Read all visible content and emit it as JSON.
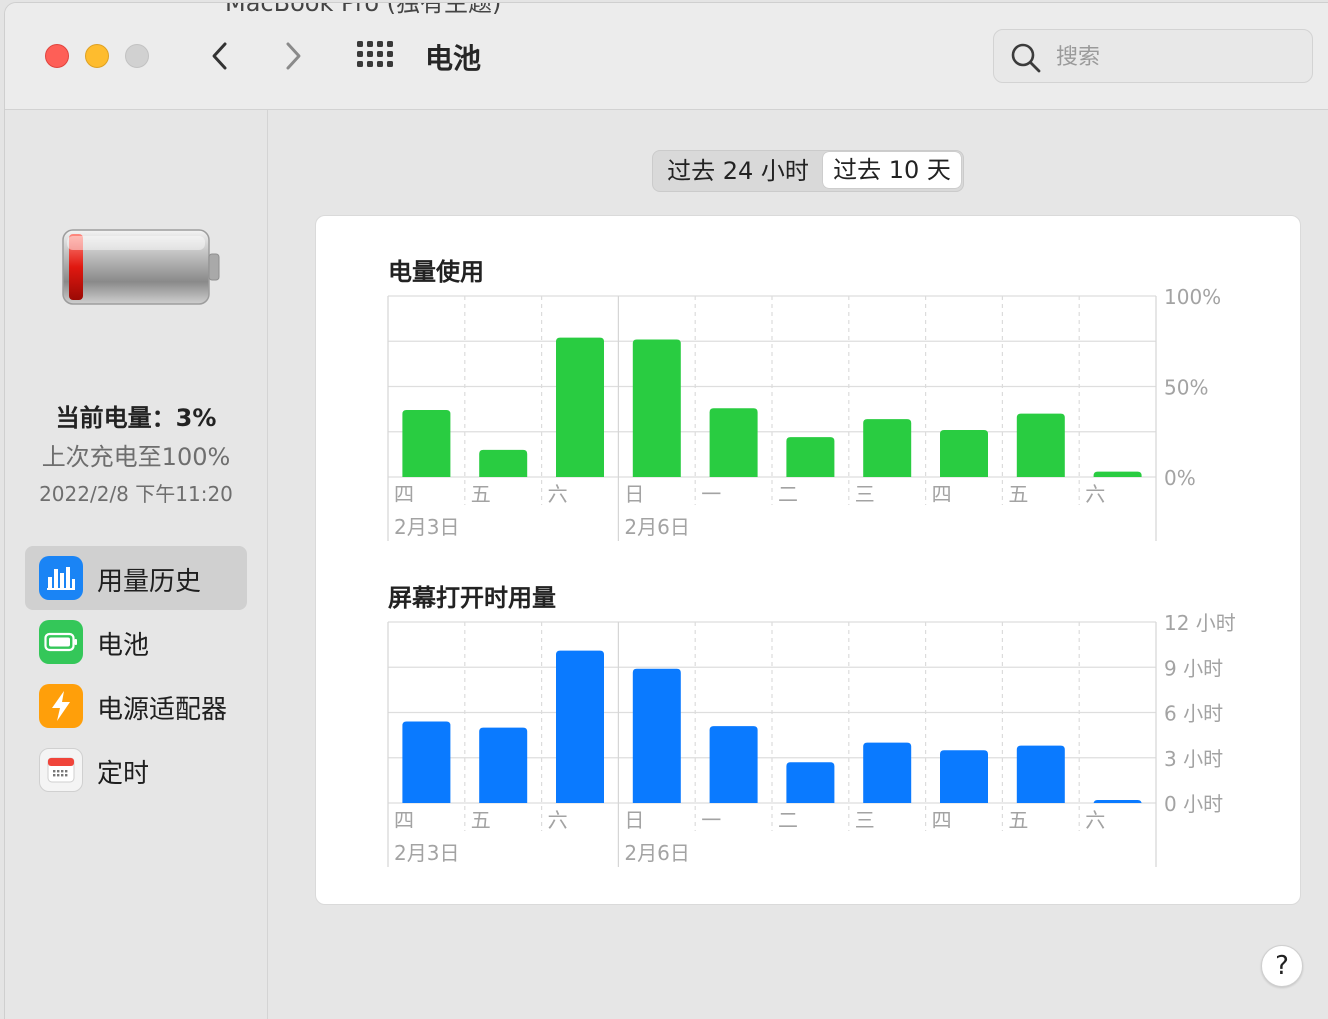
{
  "window": {
    "title": "电池",
    "ghost_title": "MacBook Pro (独有主题)"
  },
  "titlebar": {
    "search_placeholder": "搜索"
  },
  "sidebar": {
    "charge_level": "当前电量：3%",
    "last_charged": "上次充电至100%",
    "last_charged_time": "2022/2/8 下午11:20",
    "items": [
      {
        "label": "用量历史",
        "icon": "bar-chart-icon",
        "active": true
      },
      {
        "label": "电池",
        "icon": "battery-icon",
        "active": false
      },
      {
        "label": "电源适配器",
        "icon": "lightning-icon",
        "active": false
      },
      {
        "label": "定时",
        "icon": "calendar-icon",
        "active": false
      }
    ]
  },
  "range": {
    "option_24h": "过去 24 小时",
    "option_10d": "过去 10 天",
    "selected": "option_10d"
  },
  "chart_data": [
    {
      "type": "bar",
      "title": "电量使用",
      "categories": [
        "四",
        "五",
        "六",
        "日",
        "一",
        "二",
        "三",
        "四",
        "五",
        "六"
      ],
      "date_labels": [
        {
          "index": 0,
          "label": "2月3日"
        },
        {
          "index": 3,
          "label": "2月6日"
        }
      ],
      "values": [
        37,
        15,
        77,
        76,
        38,
        22,
        32,
        26,
        35,
        3
      ],
      "ylim": [
        0,
        100
      ],
      "y_ticks": [
        "100%",
        "50%",
        "0%"
      ],
      "color": "#29cc41"
    },
    {
      "type": "bar",
      "title": "屏幕打开时用量",
      "categories": [
        "四",
        "五",
        "六",
        "日",
        "一",
        "二",
        "三",
        "四",
        "五",
        "六"
      ],
      "date_labels": [
        {
          "index": 0,
          "label": "2月3日"
        },
        {
          "index": 3,
          "label": "2月6日"
        }
      ],
      "values": [
        5.4,
        5.0,
        10.1,
        8.9,
        5.1,
        2.7,
        4.0,
        3.5,
        3.8,
        0.1
      ],
      "ylim": [
        0,
        12
      ],
      "y_ticks": [
        "12 小时",
        "9 小时",
        "6 小时",
        "3 小时",
        "0 小时"
      ],
      "color": "#0a7aff"
    }
  ],
  "help": {
    "label": "?"
  }
}
